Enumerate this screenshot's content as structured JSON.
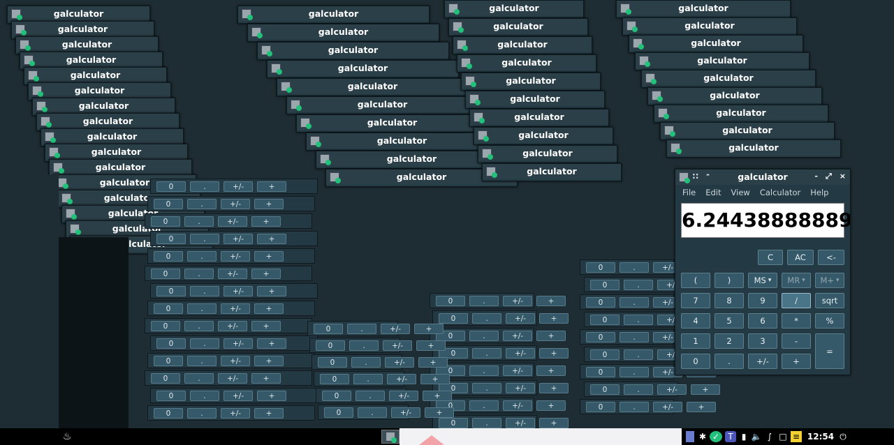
{
  "app": {
    "title": "galculator",
    "title_dots": "::",
    "title_dash": "-",
    "window_buttons": [
      "-",
      "⤢",
      "×"
    ]
  },
  "menu": [
    "File",
    "Edit",
    "View",
    "Calculator",
    "Help"
  ],
  "display": {
    "value": "6.24438888889"
  },
  "buttons": {
    "c": "C",
    "ac": "AC",
    "back": "<-",
    "paren_open": "(",
    "paren_close": ")",
    "ms": "MS",
    "mr": "MR",
    "mplus": "M+",
    "n7": "7",
    "n8": "8",
    "n9": "9",
    "div": "/",
    "sqrt": "sqrt",
    "n4": "4",
    "n5": "5",
    "n6": "6",
    "mul": "*",
    "pct": "%",
    "n1": "1",
    "n2": "2",
    "n3": "3",
    "minus": "-",
    "n0": "0",
    "dot": ".",
    "neg": "+/-",
    "plus": "+",
    "eq": "="
  },
  "background_row_labels": [
    "0",
    ".",
    "+/-",
    "+"
  ],
  "taskbar": {
    "clock": "12:54",
    "power_icon": "power-icon",
    "launcher_icon": "fire-icon"
  },
  "colors": {
    "window_bg": "#233a44",
    "button_bg": "#36596a",
    "tray_green": "#22c07a"
  }
}
